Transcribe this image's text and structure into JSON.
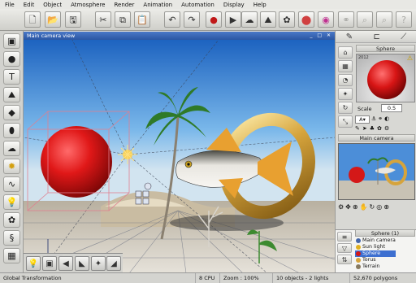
{
  "menu": [
    "File",
    "Edit",
    "Object",
    "Atmosphere",
    "Render",
    "Animation",
    "Automation",
    "Display",
    "Help"
  ],
  "viewport": {
    "title": "Main camera view",
    "window_controls": "_ □ ✕"
  },
  "right_panel": {
    "sphere_title": "Sphere",
    "warning": "⚠",
    "scale_label": "Scale",
    "scale_value": "0.5",
    "camera_title": "Main camera",
    "tree_title": "Sphere (1)",
    "tree_items": [
      "Main camera",
      "Sun light",
      "Sphere",
      "Torus",
      "Terrain"
    ],
    "selected_item": "Sphere",
    "preview_text": "2012"
  },
  "status": {
    "mode": "Global Transformation",
    "cpu": "8 CPU",
    "zoom": "Zoom : 100%",
    "objects": "10 objects - 2 lights",
    "polygons": "52,670 polygons"
  },
  "colors": {
    "sphere": "#d41818",
    "ring": "#d8a640",
    "sky": "#6aaee8",
    "selection": "#3d6fd0"
  }
}
